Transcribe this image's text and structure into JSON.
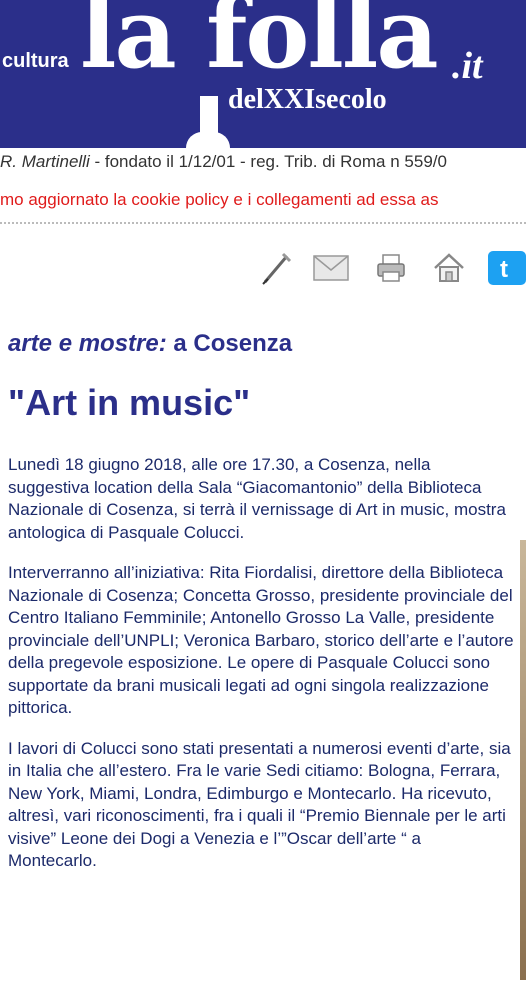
{
  "header": {
    "cultura": "cultura",
    "logo_main": "la folla",
    "logo_tld": ".it",
    "logo_sub": "delXXIsecolo",
    "bg_color": "#2b2f8a"
  },
  "info_line": {
    "author": "R. Martinelli",
    "rest": " - fondato il 1/12/01 - reg. Trib. di Roma n 559/0"
  },
  "notice": "mo aggiornato la cookie policy e i collegamenti ad essa as",
  "toolbar": {
    "icons": [
      "pen-icon",
      "mail-icon",
      "print-icon",
      "home-icon",
      "twitter-icon"
    ]
  },
  "section": {
    "category": "arte e mostre:",
    "location": " a Cosenza"
  },
  "title": "\"Art in music\"",
  "article": {
    "paragraphs": [
      "Lunedì 18 giugno 2018, alle ore 17.30, a Cosenza, nella suggestiva location della Sala “Giacomantonio” della Biblioteca Nazionale di Cosenza, si terrà il vernissage di Art in music, mostra antologica di Pasquale Colucci.",
      "Interverranno all’iniziativa: Rita Fiordalisi, direttore della Biblioteca Nazionale di Cosenza; Concetta Grosso, presidente provinciale del Centro Italiano Femminile; Antonello Grosso La Valle, presidente provinciale dell’UNPLI; Veronica Barbaro, storico dell’arte e l’autore della pregevole esposizione. Le opere di Pasquale Colucci sono supportate da brani musicali legati ad ogni singola realizzazione pittorica.",
      "I lavori di Colucci sono stati presentati a numerosi eventi d’arte, sia in Italia che all’estero. Fra le varie Sedi citiamo: Bologna, Ferrara, New York, Miami, Londra, Edimburgo e Montecarlo. Ha ricevuto, altresì, vari riconoscimenti, fra i quali il “Premio Biennale per le arti visive” Leone dei Dogi a Venezia e l’”Oscar dell’arte “ a Montecarlo."
    ]
  },
  "colors": {
    "brand_blue": "#2b2f8a",
    "notice_red": "#e01b1b",
    "text_blue": "#1c2a6a"
  }
}
